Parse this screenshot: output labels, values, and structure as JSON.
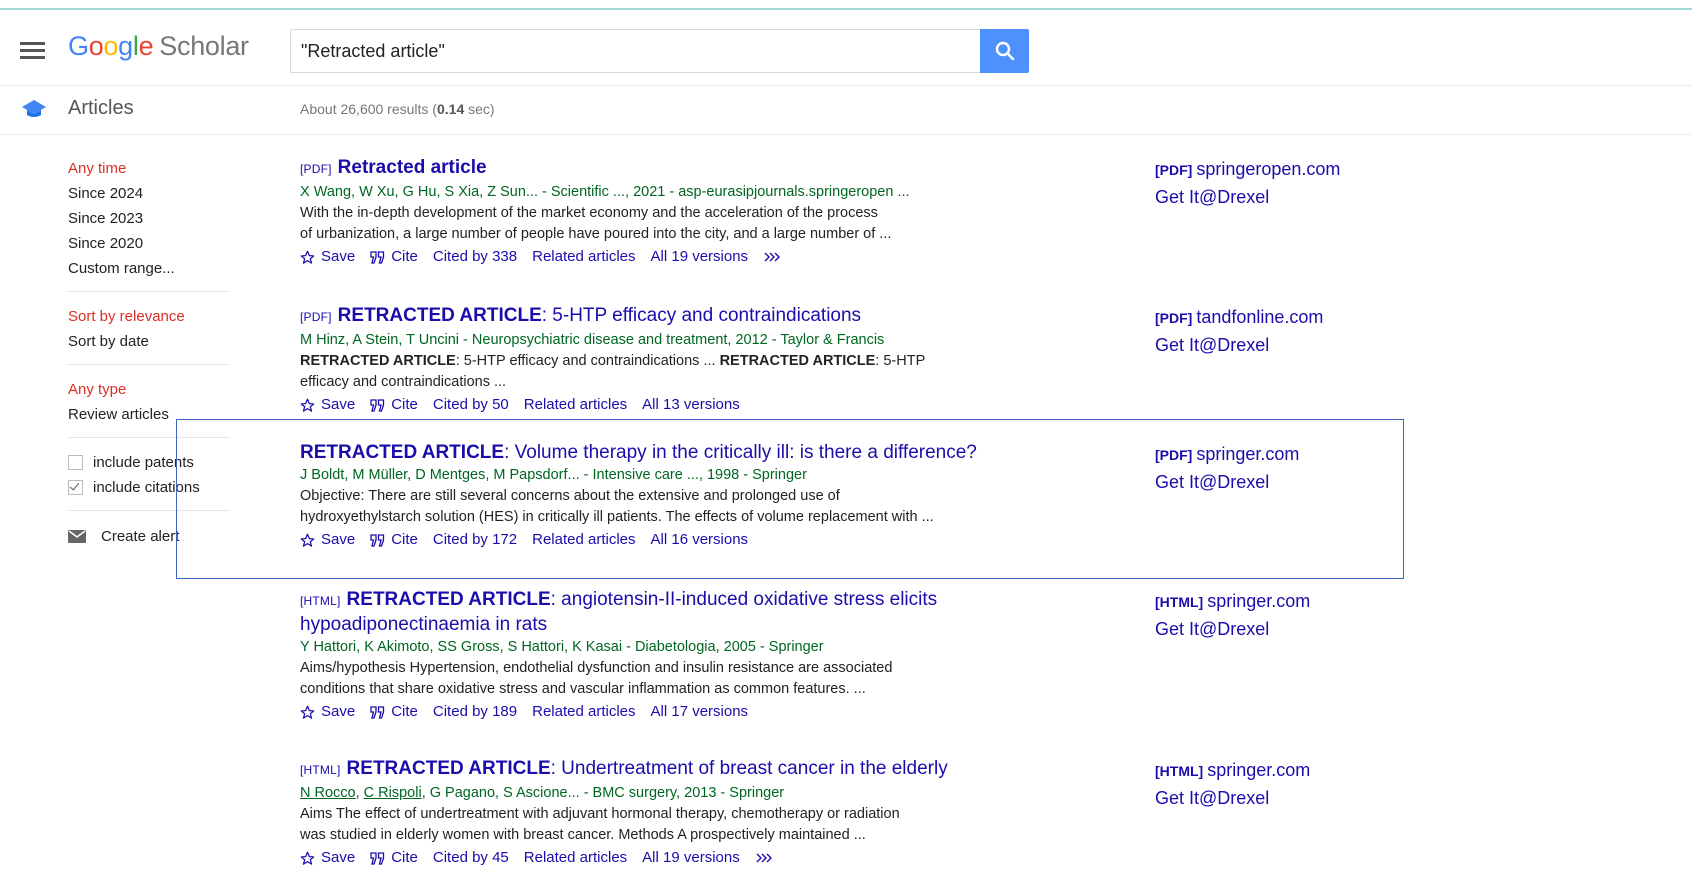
{
  "header": {
    "logo": {
      "g1": "G",
      "o1": "o",
      "o2": "o",
      "g2": "g",
      "l": "l",
      "e": "e",
      "scholar": "Scholar"
    },
    "search": {
      "value": "\"Retracted article\""
    }
  },
  "subbar": {
    "label": "Articles",
    "results_prefix": "About 26,600 results (",
    "results_time": "0.14",
    "results_suffix": " sec)"
  },
  "sidebar": {
    "time": [
      "Any time",
      "Since 2024",
      "Since 2023",
      "Since 2020",
      "Custom range..."
    ],
    "sort": [
      "Sort by relevance",
      "Sort by date"
    ],
    "type": [
      "Any type",
      "Review articles"
    ],
    "checks": [
      {
        "label": "include patents",
        "checked": false
      },
      {
        "label": "include citations",
        "checked": true
      }
    ],
    "alert": "Create alert"
  },
  "results": [
    {
      "tag": "[PDF]",
      "title_bold": "Retracted article",
      "title_rest": "",
      "authors": "X Wang, W Xu, G Hu, S Xia, Z Sun... - Scientific ..., 2021 - asp-eurasipjournals.springeropen ...",
      "snippet_line1": "With the in-depth development of the market economy and the acceleration of the process",
      "snippet_line2": "of urbanization, a large number of people have poured into the city, and a large number of ...",
      "save": "Save",
      "cite": "Cite",
      "cited": "Cited by 338",
      "related": "Related articles",
      "versions": "All 19 versions",
      "side_tag": "[PDF]",
      "side_src": "springeropen.com",
      "get": "Get It@Drexel"
    },
    {
      "tag": "[PDF]",
      "title_bold": "RETRACTED ARTICLE",
      "title_rest": ": 5-HTP efficacy and contraindications",
      "authors": "M Hinz, A Stein, T Uncini - Neuropsychiatric disease and treatment, 2012 - Taylor & Francis",
      "snippet_b1": "RETRACTED ARTICLE",
      "snippet_t1": ": 5-HTP efficacy and contraindications ... ",
      "snippet_b2": "RETRACTED ARTICLE",
      "snippet_t2": ": 5-HTP",
      "snippet_line2": "efficacy and contraindications ...",
      "save": "Save",
      "cite": "Cite",
      "cited": "Cited by 50",
      "related": "Related articles",
      "versions": "All 13 versions",
      "side_tag": "[PDF]",
      "side_src": "tandfonline.com",
      "get": "Get It@Drexel"
    },
    {
      "tag": "",
      "title_bold": "RETRACTED ARTICLE",
      "title_rest": ": Volume therapy in the critically ill: is there a difference?",
      "authors": "J Boldt, M Müller, D Mentges, M Papsdorf... - Intensive care ..., 1998 - Springer",
      "snippet_line1": "Objective: There are still several concerns about the extensive and prolonged use of",
      "snippet_line2": "hydroxyethylstarch solution (HES) in critically ill patients. The effects of volume replacement with ...",
      "save": "Save",
      "cite": "Cite",
      "cited": "Cited by 172",
      "related": "Related articles",
      "versions": "All 16 versions",
      "side_tag": "[PDF]",
      "side_src": "springer.com",
      "get": "Get It@Drexel"
    },
    {
      "tag": "[HTML]",
      "title_bold": "RETRACTED ARTICLE",
      "title_rest": ": angiotensin-II-induced oxidative stress elicits",
      "title_line2": "hypoadiponectinaemia in rats",
      "authors": "Y Hattori, K Akimoto, SS Gross, S Hattori, K Kasai - Diabetologia, 2005 - Springer",
      "snippet_line1": "Aims/hypothesis Hypertension, endothelial dysfunction and insulin resistance are associated",
      "snippet_line2": "conditions that share oxidative stress and vascular inflammation as common features. ...",
      "save": "Save",
      "cite": "Cite",
      "cited": "Cited by 189",
      "related": "Related articles",
      "versions": "All 17 versions",
      "side_tag": "[HTML]",
      "side_src": "springer.com",
      "get": "Get It@Drexel"
    },
    {
      "tag": "[HTML]",
      "title_bold": "RETRACTED ARTICLE",
      "title_rest": ": Undertreatment of breast cancer in the elderly",
      "author_u1": "N Rocco",
      "author_sep": ", ",
      "author_u2": "C Rispoli",
      "author_rest": ", G Pagano, S Ascione... - BMC surgery, 2013 - Springer",
      "snippet_line1": "Aims The effect of undertreatment with adjuvant hormonal therapy, chemotherapy or radiation",
      "snippet_line2": "was studied in elderly women with breast cancer. Methods A prospectively maintained ...",
      "save": "Save",
      "cite": "Cite",
      "cited": "Cited by 45",
      "related": "Related articles",
      "versions": "All 19 versions",
      "side_tag": "[HTML]",
      "side_src": "springer.com",
      "get": "Get It@Drexel"
    }
  ],
  "colors": {
    "link": "#1a0dab",
    "author": "#006621",
    "active": "#d93025",
    "search_button": "#4d90fe",
    "selection": "#3b66c5"
  }
}
